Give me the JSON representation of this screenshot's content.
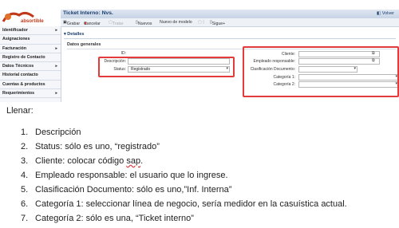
{
  "app": {
    "logo_text": "absortible",
    "window_title": "Ticket Interno: Nvs.",
    "back_label": "Volver"
  },
  "sidebar": {
    "items": [
      {
        "label": "Identificador",
        "arrow": true
      },
      {
        "label": "Asignaciones",
        "arrow": false
      },
      {
        "label": "Facturación",
        "arrow": true
      },
      {
        "label": "Registro de Contacto",
        "arrow": false
      },
      {
        "label": "Datos Técnicos",
        "arrow": true
      },
      {
        "label": "Historial contacto",
        "arrow": false
      },
      {
        "label": "Cuentas & productos",
        "arrow": false
      },
      {
        "label": "Requerimientos",
        "arrow": true
      }
    ]
  },
  "toolbar": {
    "save": "Grabar",
    "cancel": "Cancelar",
    "test": "Tratar",
    "new": "Nuevos",
    "model": "Nuevo de modelo",
    "next": "Sigue+"
  },
  "form": {
    "section_details": "Detalles",
    "section_general": "Datos generales",
    "id_label": "ID:",
    "description_label": "Descripción:",
    "status_label": "Status:",
    "status_value": "Registrado",
    "client_label": "Cliente:",
    "responsible_label": "Empleado responsable:",
    "classification_label": "Clasificación Documento:",
    "category1_label": "Categoría 1:",
    "category2_label": "Categoría 2:"
  },
  "instructions": {
    "heading": "Llenar:",
    "items": [
      {
        "num": "1.",
        "text": "Descripción"
      },
      {
        "num": "2.",
        "text": "Status: sólo es uno, “registrado”"
      },
      {
        "num": "3.",
        "text_before": "Cliente: colocar código ",
        "text_underlined": "sap",
        "text_after": "."
      },
      {
        "num": "4.",
        "text": "Empleado responsable: el usuario que lo ingrese."
      },
      {
        "num": "5.",
        "text": "Clasificación Documento: sólo es uno,”Inf. Interna”"
      },
      {
        "num": "6.",
        "text": "Categoría 1: seleccionar línea de negocio, sería medidor en la casuística actual."
      },
      {
        "num": "7.",
        "text": "Categoría 2: sólo es una, “Ticket interno”"
      }
    ]
  },
  "colors": {
    "highlight": "#e23b3b",
    "title_text": "#1b3d6e"
  }
}
